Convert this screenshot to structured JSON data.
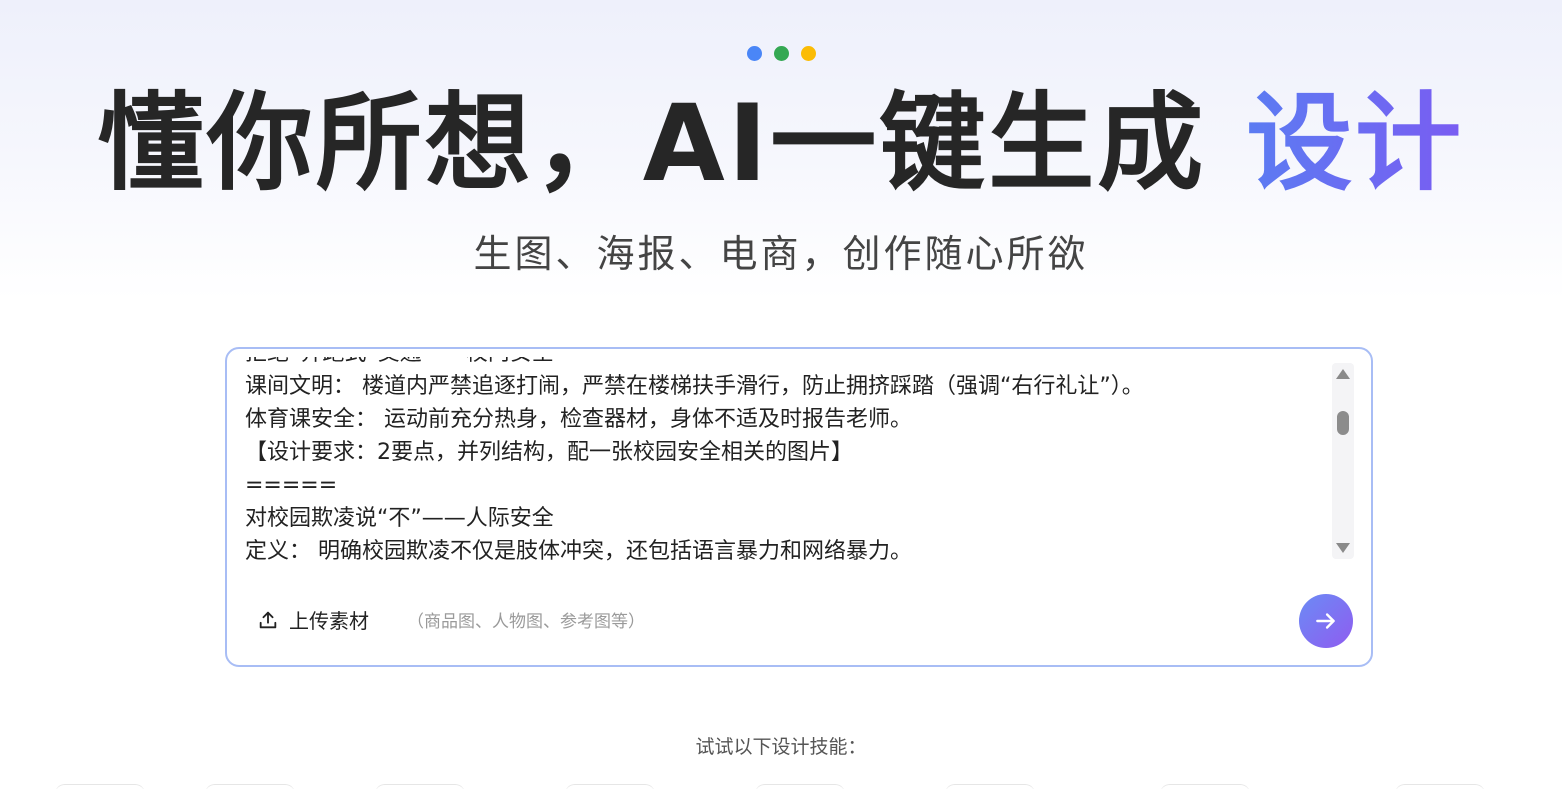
{
  "header": {
    "dot_colors": [
      "#4a86f7",
      "#34a853",
      "#fbbc05"
    ],
    "title_main": "懂你所想，",
    "title_ai": "AI",
    "title_rest": "一键生成 ",
    "title_accent": "设计",
    "accent_color": "#6a6cf2",
    "subtitle": "生图、海报、电商，创作随心所欲"
  },
  "prompt": {
    "text": "拒绝“奔跑式”交通——校内安全\n课间文明： 楼道内严禁追逐打闹，严禁在楼梯扶手滑行，防止拥挤踩踏（强调“右行礼让”）。\n体育课安全： 运动前充分热身，检查器材，身体不适及时报告老师。\n【设计要求：2要点，并列结构，配一张校园安全相关的图片】\n=====\n对校园欺凌说“不”——人际安全\n定义： 明确校园欺凌不仅是肢体冲突，还包括语言暴力和网络暴力。",
    "upload_label": "上传素材",
    "upload_hint": "（商品图、人物图、参考图等）",
    "border_color": "#a8bdf5"
  },
  "skills": {
    "label": "试试以下设计技能："
  }
}
